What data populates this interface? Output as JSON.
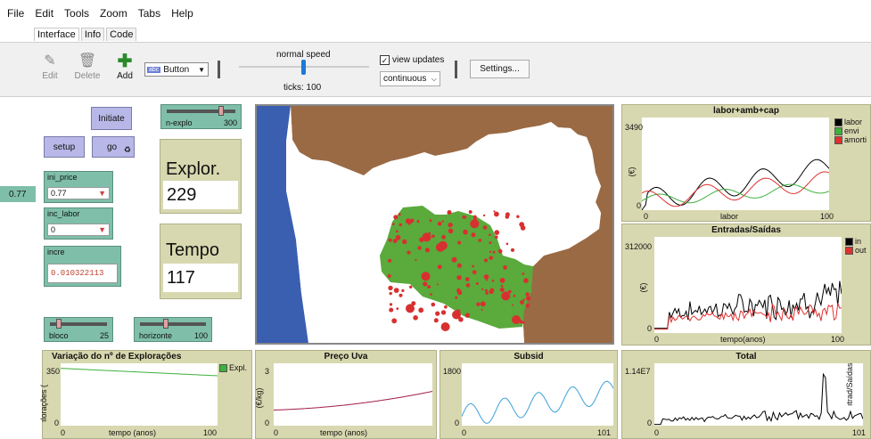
{
  "menu": [
    "File",
    "Edit",
    "Tools",
    "Zoom",
    "Tabs",
    "Help"
  ],
  "tabs": [
    "Interface",
    "Info",
    "Code"
  ],
  "toolbar": {
    "edit_label": "Edit",
    "delete_label": "Delete",
    "add_label": "Add",
    "widget_select": "Button",
    "widget_abc": "abc",
    "speed_label": "normal speed",
    "ticks_label": "ticks: 100",
    "view_updates_label": "view updates",
    "update_mode": "continuous",
    "settings_label": "Settings..."
  },
  "widgets": {
    "initiate_label": "Initiate",
    "setup_label": "setup",
    "go_label": "go",
    "n_explo": {
      "label": "n-explo",
      "value": "300",
      "fraction": 0.82
    },
    "ini_price": {
      "label": "ini_price",
      "value": "0.77",
      "side_value": "0.77"
    },
    "inc_labor": {
      "label": "inc_labor",
      "value": "0"
    },
    "incre": {
      "label": "incre",
      "value": "0.010322113"
    },
    "explor_monitor": {
      "label": "Explor.",
      "value": "229"
    },
    "tempo_monitor": {
      "label": "Tempo",
      "value": "117"
    },
    "bloco": {
      "label": "bloco",
      "value": "25",
      "fraction": 0.12
    },
    "horizonte": {
      "label": "horizonte",
      "value": "100",
      "fraction": 0.38
    }
  },
  "plots": {
    "labor": {
      "title": "labor+amb+cap",
      "ymax": "3490",
      "ymin": "0",
      "xmin": "0",
      "xmax": "100",
      "ylabel": "(€)",
      "xlabel": "labor",
      "legend": [
        {
          "name": "labor",
          "color": "#000000"
        },
        {
          "name": "envi",
          "color": "#3db03d"
        },
        {
          "name": "amorti",
          "color": "#e03030"
        }
      ]
    },
    "entradas": {
      "title": "Entradas/Saídas",
      "ymax": "312000",
      "ymin": "0",
      "xmin": "0",
      "xmax": "100",
      "ylabel": "(€)",
      "xlabel": "tempo(anos)",
      "legend": [
        {
          "name": "in",
          "color": "#000000"
        },
        {
          "name": "out",
          "color": "#e03030"
        }
      ]
    },
    "variacao": {
      "title": "Variação do nº de Explorações",
      "ymax": "350",
      "ymin": "0",
      "xmin": "0",
      "xmax": "100",
      "ylabel": "ılorações (",
      "xlabel": "tempo (anos)",
      "legend": [
        {
          "name": "Expl.",
          "color": "#3db03d"
        }
      ]
    },
    "preco": {
      "title": "Preço Uva",
      "ymax": "3",
      "ymin": "0",
      "xmin": "0",
      "xmax": "",
      "ylabel": "(€/kg)",
      "xlabel": "tempo (anos)"
    },
    "subsid": {
      "title": "Subsid",
      "ymax": "1800",
      "ymin": "0",
      "xmin": "0",
      "xmax": "101"
    },
    "total": {
      "title": "Total",
      "ymax": "1.14E7",
      "ymin": "0",
      "xmin": "0",
      "xmax": "101",
      "ylabel": "ıtrad/Saídas"
    }
  },
  "colors": {
    "water": "#3a5fb0",
    "land": "#9a6a44",
    "field": "#5aaa3c",
    "parcel": "#d83030",
    "view_bg": "#ffffff"
  }
}
